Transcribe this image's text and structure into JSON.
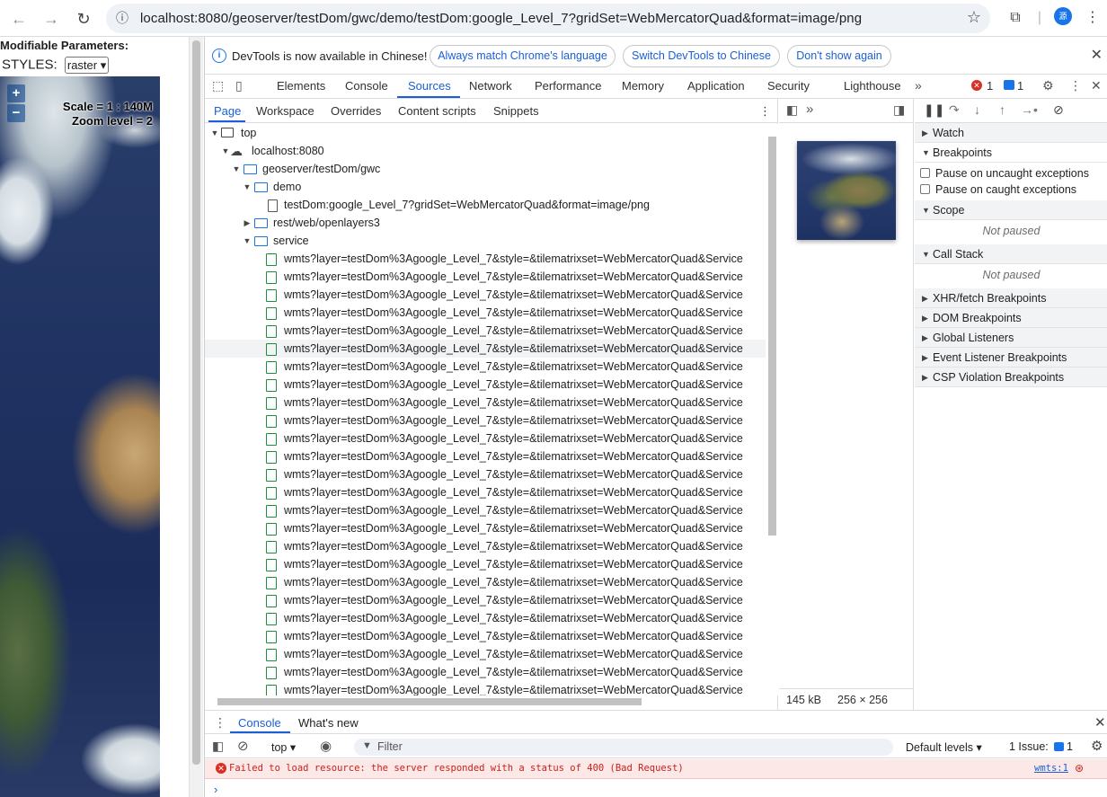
{
  "browser": {
    "url": "localhost:8080/geoserver/testDom/gwc/demo/testDom:google_Level_7?gridSet=WebMercatorQuad&format=image/png",
    "profile_initial": "源"
  },
  "page": {
    "params_title": "Modifiable Parameters:",
    "styles_label": "STYLES:",
    "styles_value": "raster ▾",
    "zoom_in": "+",
    "zoom_out": "−",
    "scale_text": "Scale = 1 : 140M",
    "zoom_level_text": "Zoom level = 2"
  },
  "infobar": {
    "message": "DevTools is now available in Chinese!",
    "btn_match": "Always match Chrome's language",
    "btn_switch": "Switch DevTools to Chinese",
    "btn_dismiss": "Don't show again"
  },
  "top_tabs": [
    "Elements",
    "Console",
    "Sources",
    "Network",
    "Performance",
    "Memory",
    "Application",
    "Security",
    "Lighthouse"
  ],
  "top_badges": {
    "errors": "1",
    "messages": "1"
  },
  "nav_tabs": [
    "Page",
    "Workspace",
    "Overrides",
    "Content scripts",
    "Snippets"
  ],
  "tree": {
    "top": "top",
    "host": "localhost:8080",
    "gwc": "geoserver/testDom/gwc",
    "demo": "demo",
    "demo_file": "testDom:google_Level_7?gridSet=WebMercatorQuad&format=image/png",
    "openlayers": "rest/web/openlayers3",
    "service": "service",
    "wmts_item": "wmts?layer=testDom%3Agoogle_Level_7&style=&tilematrixset=WebMercatorQuad&Service"
  },
  "preview": {
    "size": "145 kB",
    "dims": "256 × 256"
  },
  "debugger": {
    "watch": "Watch",
    "breakpoints": "Breakpoints",
    "pause_uncaught": "Pause on uncaught exceptions",
    "pause_caught": "Pause on caught exceptions",
    "scope": "Scope",
    "not_paused": "Not paused",
    "call_stack": "Call Stack",
    "xhr": "XHR/fetch Breakpoints",
    "dom": "DOM Breakpoints",
    "global": "Global Listeners",
    "event": "Event Listener Breakpoints",
    "csp": "CSP Violation Breakpoints"
  },
  "drawer": {
    "tab_console": "Console",
    "tab_whatsnew": "What's new",
    "context": "top ▾",
    "filter_placeholder": "Filter",
    "levels": "Default levels ▾",
    "issues_label": "1 Issue:",
    "issues_count": "1",
    "error_text": "Failed to load resource: the server responded with a status of 400 (Bad Request)",
    "error_source": "wmts:1",
    "prompt": "›"
  }
}
